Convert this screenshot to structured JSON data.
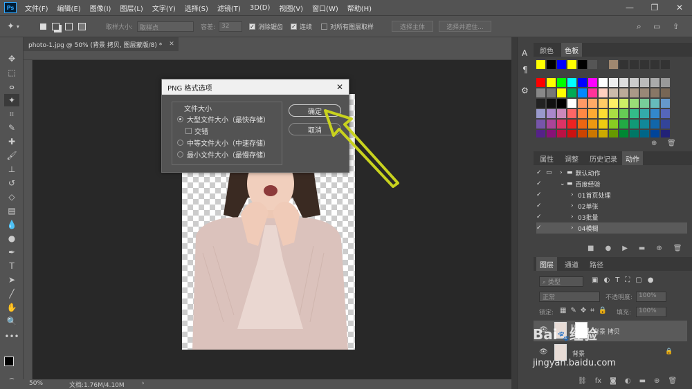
{
  "app": {
    "logo": "Ps",
    "menus": [
      "文件(F)",
      "编辑(E)",
      "图像(I)",
      "图层(L)",
      "文字(Y)",
      "选择(S)",
      "滤镜(T)",
      "3D(D)",
      "视图(V)",
      "窗口(W)",
      "帮助(H)"
    ],
    "controls": [
      "—",
      "❐",
      "✕"
    ]
  },
  "options": {
    "sample_size_label": "取样大小:",
    "sample_size_value": "取样点",
    "tolerance_label": "容差:",
    "tolerance_value": "32",
    "antialias_label": "消除锯齿",
    "contiguous_label": "连续",
    "all_layers_label": "对所有图层取样",
    "select_subject": "选择主体",
    "select_mask": "选择并遮住..."
  },
  "document": {
    "tab_title": "photo-1.jpg @ 50% (背景 拷贝, 图层蒙版/8) *",
    "zoom": "50%",
    "doc_info": "文档:1.76M/4.10M"
  },
  "dialog": {
    "title": "PNG 格式选项",
    "group_label": "文件大小",
    "options": [
      {
        "label": "大型文件大小（最快存储）",
        "selected": true
      },
      {
        "label": "交错",
        "selected": false
      },
      {
        "label": "中等文件大小（中速存储）",
        "selected": false
      },
      {
        "label": "最小文件大小（最慢存储）",
        "selected": false
      }
    ],
    "ok": "确定",
    "cancel": "取消"
  },
  "swatches_panel": {
    "tabs": [
      "颜色",
      "色板"
    ],
    "active": "色板"
  },
  "actions_panel": {
    "tabs": [
      "属性",
      "调整",
      "历史记录",
      "动作"
    ],
    "active": "动作",
    "items": [
      {
        "label": "默认动作",
        "type": "set"
      },
      {
        "label": "百度经验",
        "type": "set",
        "open": true
      },
      {
        "label": "01首页处理",
        "type": "action"
      },
      {
        "label": "02单张",
        "type": "action"
      },
      {
        "label": "03批量",
        "type": "action"
      },
      {
        "label": "04模糊",
        "type": "action",
        "selected": true
      }
    ]
  },
  "layers_panel": {
    "tabs": [
      "图层",
      "通道",
      "路径"
    ],
    "active": "图层",
    "filter": "类型",
    "blend_mode": "正常",
    "opacity_label": "不透明度:",
    "opacity_value": "100%",
    "lock_label": "锁定:",
    "fill_label": "填充:",
    "fill_value": "100%",
    "layers": [
      {
        "name": "背景 拷贝",
        "selected": true
      },
      {
        "name": "背景",
        "locked": true
      }
    ]
  },
  "watermark": {
    "brand": "Bai",
    "text": "经验",
    "url": "jingyan.baidu.com"
  },
  "colors": {
    "accent": "#c8d21e"
  }
}
